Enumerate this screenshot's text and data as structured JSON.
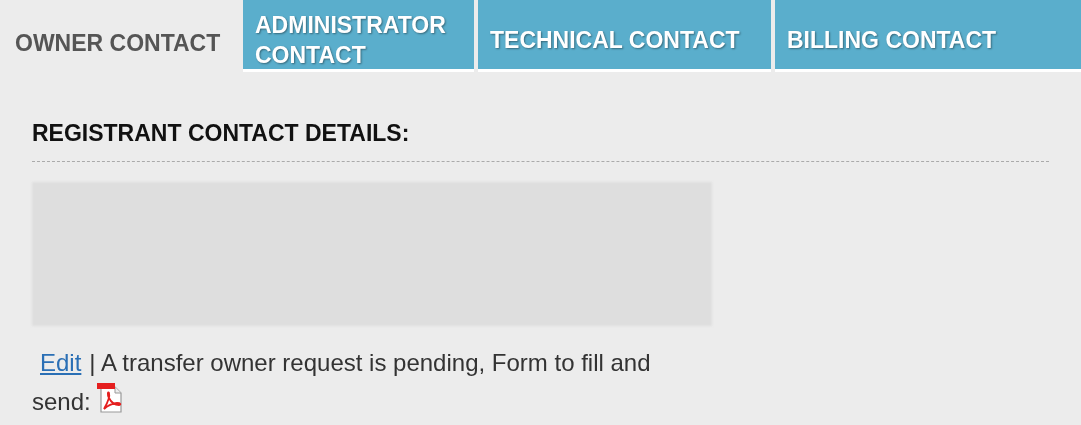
{
  "tabs": [
    {
      "label": "OWNER CONTACT",
      "selected": true
    },
    {
      "label": "ADMINISTRATOR CONTACT",
      "selected": false
    },
    {
      "label": "TECHNICAL CONTACT",
      "selected": false
    },
    {
      "label": "BILLING CONTACT",
      "selected": false
    }
  ],
  "section": {
    "heading": "REGISTRANT CONTACT DETAILS:",
    "edit_link": "Edit",
    "notice": "| A transfer owner request is pending, Form to fill and send:"
  }
}
